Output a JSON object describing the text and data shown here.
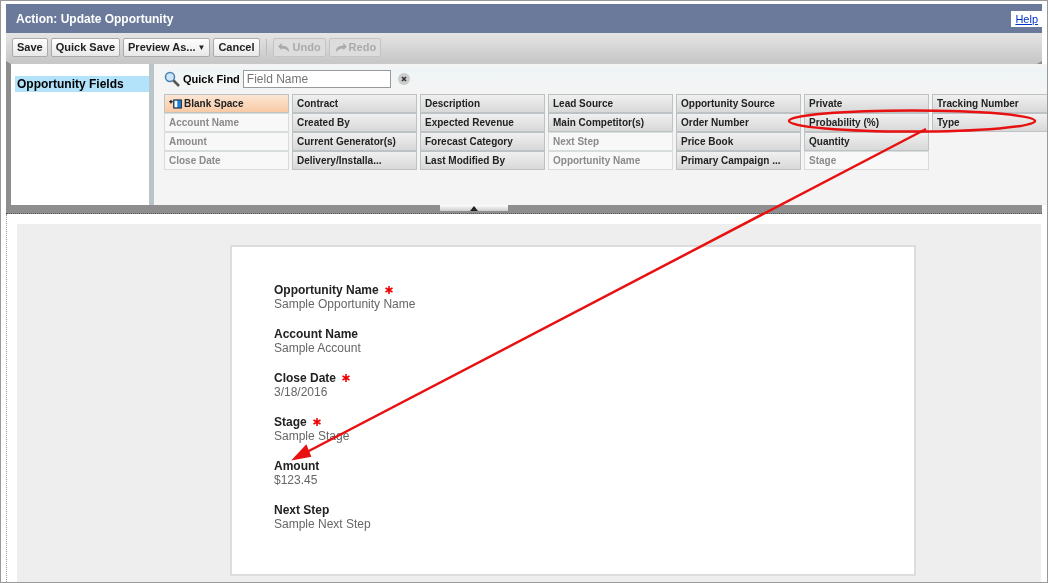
{
  "window": {
    "title": "Action: Update Opportunity",
    "help_link": "Help"
  },
  "toolbar": [
    {
      "label": "Save",
      "disabled": false,
      "kind": "text"
    },
    {
      "label": "Quick Save",
      "disabled": false,
      "kind": "text"
    },
    {
      "label": "Preview As...",
      "disabled": false,
      "kind": "dropdown",
      "caret": "▼"
    },
    {
      "label": "Cancel",
      "disabled": false,
      "kind": "text"
    },
    {
      "label": "Undo",
      "disabled": true,
      "kind": "undo"
    },
    {
      "label": "Redo",
      "disabled": true,
      "kind": "redo"
    }
  ],
  "sidebar": {
    "items": [
      {
        "label": "Opportunity Fields",
        "selected": true
      }
    ]
  },
  "quick_find": {
    "label": "Quick Find",
    "placeholder": "Field Name"
  },
  "field_rows": [
    [
      {
        "label": "Blank Space",
        "kind": "blank",
        "used": false
      },
      {
        "label": "Contract",
        "kind": "field",
        "used": false
      },
      {
        "label": "Description",
        "kind": "field",
        "used": false
      },
      {
        "label": "Lead Source",
        "kind": "field",
        "used": false
      },
      {
        "label": "Opportunity Source",
        "kind": "field",
        "used": false
      },
      {
        "label": "Private",
        "kind": "field",
        "used": false
      },
      {
        "label": "Tracking Number",
        "kind": "field",
        "used": false
      }
    ],
    [
      {
        "label": "Account Name",
        "kind": "field",
        "used": true
      },
      {
        "label": "Created By",
        "kind": "field",
        "used": false
      },
      {
        "label": "Expected Revenue",
        "kind": "field",
        "used": false
      },
      {
        "label": "Main Competitor(s)",
        "kind": "field",
        "used": false
      },
      {
        "label": "Order Number",
        "kind": "field",
        "used": false
      },
      {
        "label": "Probability (%)",
        "kind": "field",
        "used": false
      },
      {
        "label": "Type",
        "kind": "field",
        "used": false
      }
    ],
    [
      {
        "label": "Amount",
        "kind": "field",
        "used": true
      },
      {
        "label": "Current Generator(s)",
        "kind": "field",
        "used": false
      },
      {
        "label": "Forecast Category",
        "kind": "field",
        "used": false
      },
      {
        "label": "Next Step",
        "kind": "field",
        "used": true
      },
      {
        "label": "Price Book",
        "kind": "field",
        "used": false
      },
      {
        "label": "Quantity",
        "kind": "field",
        "used": false
      }
    ],
    [
      {
        "label": "Close Date",
        "kind": "field",
        "used": true
      },
      {
        "label": "Delivery/Installa...",
        "kind": "field",
        "used": false
      },
      {
        "label": "Last Modified By",
        "kind": "field",
        "used": false
      },
      {
        "label": "Opportunity Name",
        "kind": "field",
        "used": true
      },
      {
        "label": "Primary Campaign ...",
        "kind": "field",
        "used": false
      },
      {
        "label": "Stage",
        "kind": "field",
        "used": true
      }
    ]
  ],
  "layout_fields": [
    {
      "label": "Opportunity Name",
      "value": "Sample Opportunity Name",
      "required": true
    },
    {
      "label": "Account Name",
      "value": "Sample Account",
      "required": false
    },
    {
      "label": "Close Date",
      "value": "3/18/2016",
      "required": true
    },
    {
      "label": "Stage",
      "value": "Sample Stage",
      "required": true
    },
    {
      "label": "Amount",
      "value": "$123.45",
      "required": false
    },
    {
      "label": "Next Step",
      "value": "Sample Next Step",
      "required": false
    }
  ]
}
